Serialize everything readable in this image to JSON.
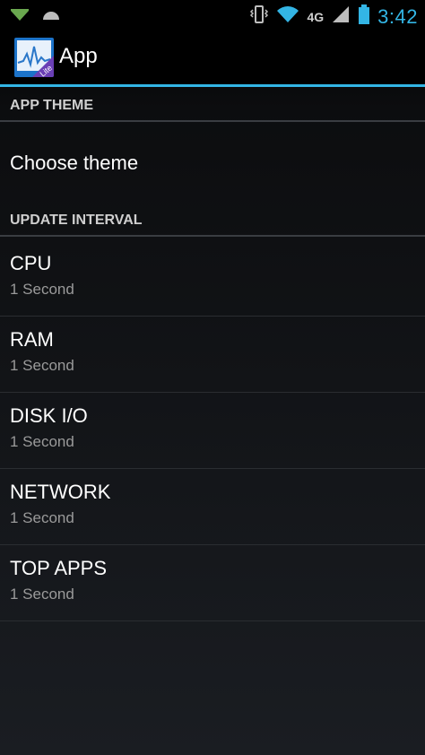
{
  "status_bar": {
    "network_type": "4G",
    "time": "3:42",
    "icons": [
      "notification-arrow-icon",
      "cloud-icon",
      "vibrate-icon",
      "wifi-icon",
      "signal-icon",
      "battery-icon"
    ]
  },
  "action_bar": {
    "title": "App",
    "icon_badge": "Lite",
    "accent_color": "#33b5e5"
  },
  "sections": {
    "app_theme": {
      "header": "APP THEME",
      "items": [
        {
          "title": "Choose theme"
        }
      ]
    },
    "update_interval": {
      "header": "UPDATE INTERVAL",
      "items": [
        {
          "title": "CPU",
          "summary": "1 Second"
        },
        {
          "title": "RAM",
          "summary": "1 Second"
        },
        {
          "title": "DISK I/O",
          "summary": "1 Second"
        },
        {
          "title": "NETWORK",
          "summary": "1 Second"
        },
        {
          "title": "TOP APPS",
          "summary": "1 Second"
        }
      ]
    }
  }
}
